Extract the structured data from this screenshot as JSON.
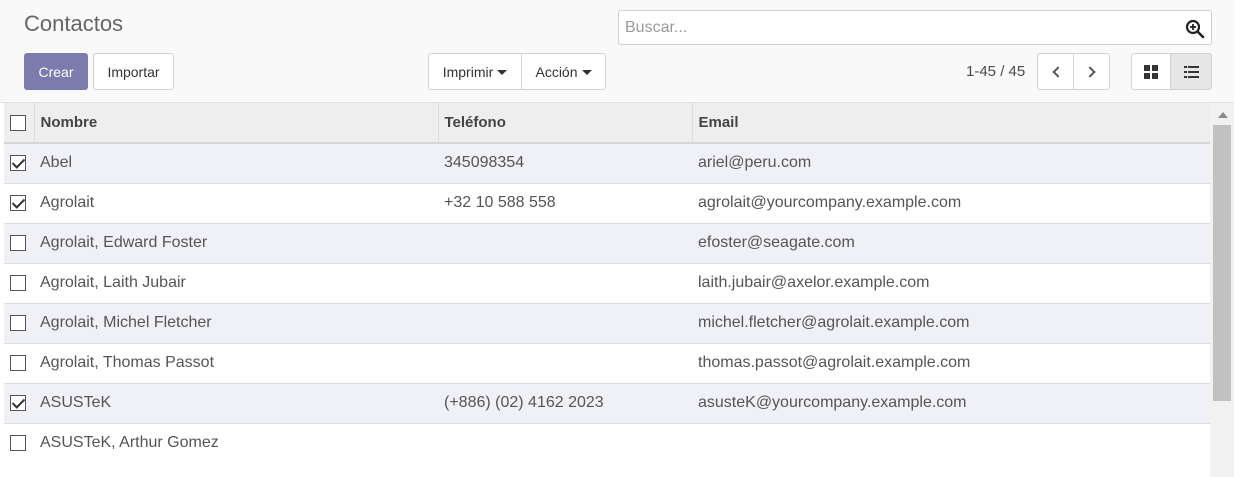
{
  "page": {
    "title": "Contactos"
  },
  "search": {
    "placeholder": "Buscar..."
  },
  "toolbar": {
    "create_label": "Crear",
    "import_label": "Importar",
    "print_label": "Imprimir",
    "action_label": "Acción"
  },
  "pager": {
    "value": "1-45 / 45"
  },
  "table": {
    "columns": [
      "Nombre",
      "Teléfono",
      "Email"
    ],
    "rows": [
      {
        "name": "Abel",
        "phone": "345098354",
        "email": "ariel@peru.com",
        "checked": true
      },
      {
        "name": "Agrolait",
        "phone": "+32 10 588 558",
        "email": "agrolait@yourcompany.example.com",
        "checked": true
      },
      {
        "name": "Agrolait, Edward Foster",
        "phone": "",
        "email": "efoster@seagate.com",
        "checked": false
      },
      {
        "name": "Agrolait, Laith Jubair",
        "phone": "",
        "email": "laith.jubair@axelor.example.com",
        "checked": false
      },
      {
        "name": "Agrolait, Michel Fletcher",
        "phone": "",
        "email": "michel.fletcher@agrolait.example.com",
        "checked": false
      },
      {
        "name": "Agrolait, Thomas Passot",
        "phone": "",
        "email": "thomas.passot@agrolait.example.com",
        "checked": false
      },
      {
        "name": "ASUSTeK",
        "phone": "(+886) (02) 4162 2023",
        "email": "asusteK@yourcompany.example.com",
        "checked": true
      },
      {
        "name": "ASUSTeK, Arthur Gomez",
        "phone": "",
        "email": "",
        "checked": false
      }
    ]
  },
  "colors": {
    "primary": "#7c7bad",
    "selected_row": "#f0f0f7"
  }
}
